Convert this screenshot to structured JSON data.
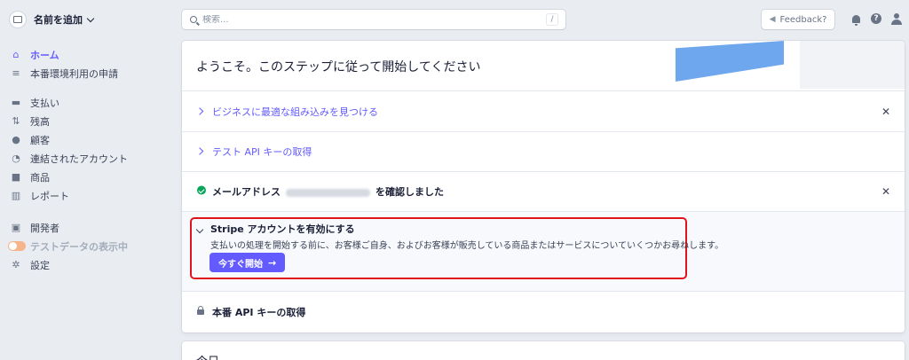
{
  "account": {
    "name": "名前を追加"
  },
  "nav": {
    "primary": [
      {
        "label": "ホーム",
        "icon": "home-icon"
      },
      {
        "label": "本番環境利用の申請",
        "icon": "checklist-icon"
      }
    ],
    "business": [
      {
        "label": "支払い",
        "icon": "wallet-icon"
      },
      {
        "label": "残高",
        "icon": "balance-arrows-icon"
      },
      {
        "label": "顧客",
        "icon": "customer-icon"
      },
      {
        "label": "連結されたアカウント",
        "icon": "connect-icon"
      },
      {
        "label": "商品",
        "icon": "product-box-icon"
      },
      {
        "label": "レポート",
        "icon": "report-chart-icon"
      }
    ],
    "developer": [
      {
        "label": "開発者",
        "icon": "terminal-icon"
      },
      {
        "label": "テストデータの表示中",
        "icon": "toggle-icon"
      },
      {
        "label": "設定",
        "icon": "gear-icon"
      }
    ]
  },
  "search": {
    "placeholder": "検索...",
    "shortcut": "/"
  },
  "feedback": {
    "label": "Feedback?"
  },
  "onboarding": {
    "title": "ようこそ。このステップに従って開始してください",
    "steps": {
      "integration": "ビジネスに最適な組み込みを見つける",
      "test_api": "テスト API キーの取得",
      "email_prefix": "メールアドレス",
      "email_suffix": "を確認しました",
      "activate_title": "Stripe アカウントを有効にする",
      "activate_desc": "支払いの処理を開始する前に、お客様ご自身、およびお客様が販売している商品またはサービスについていくつかお尋ねします。",
      "start_button": "今すぐ開始",
      "live_api": "本番 API キーの取得"
    },
    "close_glyph": "✕"
  },
  "next_card": {
    "title": "今日"
  },
  "colors": {
    "accent": "#635bff",
    "success": "#09a55a",
    "highlight": "#e0141d"
  }
}
